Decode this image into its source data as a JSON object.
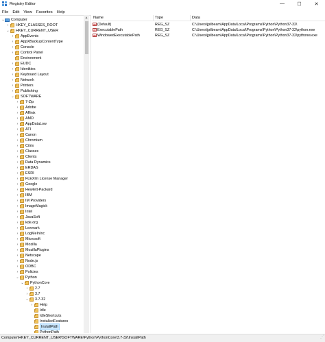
{
  "window": {
    "title": "Registry Editor",
    "minimize_glyph": "—",
    "maximize_glyph": "☐",
    "close_glyph": "✕"
  },
  "menu": [
    "File",
    "Edit",
    "View",
    "Favorites",
    "Help"
  ],
  "tree": [
    {
      "label": "Computer",
      "depth": 0,
      "expander": "⌄",
      "icon": "computer-icon"
    },
    {
      "label": "HKEY_CLASSES_ROOT",
      "depth": 1,
      "expander": "›",
      "icon": "folder-icon"
    },
    {
      "label": "HKEY_CURRENT_USER",
      "depth": 1,
      "expander": "⌄",
      "icon": "folder-icon"
    },
    {
      "label": "AppEvents",
      "depth": 2,
      "expander": "›",
      "icon": "folder-icon"
    },
    {
      "label": "AppXBackupContentType",
      "depth": 2,
      "expander": "›",
      "icon": "folder-icon"
    },
    {
      "label": "Console",
      "depth": 2,
      "expander": "›",
      "icon": "folder-icon"
    },
    {
      "label": "Control Panel",
      "depth": 2,
      "expander": "›",
      "icon": "folder-icon"
    },
    {
      "label": "Environment",
      "depth": 2,
      "expander": "",
      "icon": "folder-icon"
    },
    {
      "label": "EUDC",
      "depth": 2,
      "expander": "›",
      "icon": "folder-icon"
    },
    {
      "label": "Identities",
      "depth": 2,
      "expander": "›",
      "icon": "folder-icon"
    },
    {
      "label": "Keyboard Layout",
      "depth": 2,
      "expander": "›",
      "icon": "folder-icon"
    },
    {
      "label": "Network",
      "depth": 2,
      "expander": "›",
      "icon": "folder-icon"
    },
    {
      "label": "Printers",
      "depth": 2,
      "expander": "›",
      "icon": "folder-icon"
    },
    {
      "label": "Publishing",
      "depth": 2,
      "expander": "›",
      "icon": "folder-icon"
    },
    {
      "label": "SOFTWARE",
      "depth": 2,
      "expander": "⌄",
      "icon": "folder-icon"
    },
    {
      "label": "7-Zip",
      "depth": 3,
      "expander": "›",
      "icon": "folder-icon"
    },
    {
      "label": "Adobe",
      "depth": 3,
      "expander": "›",
      "icon": "folder-icon"
    },
    {
      "label": "Affinix",
      "depth": 3,
      "expander": "›",
      "icon": "folder-icon"
    },
    {
      "label": "AMD",
      "depth": 3,
      "expander": "›",
      "icon": "folder-icon"
    },
    {
      "label": "AppDataLow",
      "depth": 3,
      "expander": "›",
      "icon": "folder-icon"
    },
    {
      "label": "ATI",
      "depth": 3,
      "expander": "›",
      "icon": "folder-icon"
    },
    {
      "label": "Canon",
      "depth": 3,
      "expander": "›",
      "icon": "folder-icon"
    },
    {
      "label": "Chromium",
      "depth": 3,
      "expander": "›",
      "icon": "folder-icon"
    },
    {
      "label": "Citrix",
      "depth": 3,
      "expander": "›",
      "icon": "folder-icon"
    },
    {
      "label": "Classes",
      "depth": 3,
      "expander": "›",
      "icon": "folder-icon"
    },
    {
      "label": "Clients",
      "depth": 3,
      "expander": "›",
      "icon": "folder-icon"
    },
    {
      "label": "Data Dynamics",
      "depth": 3,
      "expander": "›",
      "icon": "folder-icon"
    },
    {
      "label": "ERDAS",
      "depth": 3,
      "expander": "›",
      "icon": "folder-icon"
    },
    {
      "label": "ESRI",
      "depth": 3,
      "expander": "›",
      "icon": "folder-icon"
    },
    {
      "label": "FLEXlm License Manager",
      "depth": 3,
      "expander": "›",
      "icon": "folder-icon"
    },
    {
      "label": "Google",
      "depth": 3,
      "expander": "›",
      "icon": "folder-icon"
    },
    {
      "label": "Hewlett-Packard",
      "depth": 3,
      "expander": "›",
      "icon": "folder-icon"
    },
    {
      "label": "IBM",
      "depth": 3,
      "expander": "›",
      "icon": "folder-icon"
    },
    {
      "label": "IM Providers",
      "depth": 3,
      "expander": "›",
      "icon": "folder-icon"
    },
    {
      "label": "ImageMagick",
      "depth": 3,
      "expander": "›",
      "icon": "folder-icon"
    },
    {
      "label": "Intel",
      "depth": 3,
      "expander": "›",
      "icon": "folder-icon"
    },
    {
      "label": "JavaSoft",
      "depth": 3,
      "expander": "›",
      "icon": "folder-icon"
    },
    {
      "label": "kde.org",
      "depth": 3,
      "expander": "›",
      "icon": "folder-icon"
    },
    {
      "label": "Lexmark",
      "depth": 3,
      "expander": "›",
      "icon": "folder-icon"
    },
    {
      "label": "LogMeInInc",
      "depth": 3,
      "expander": "›",
      "icon": "folder-icon"
    },
    {
      "label": "Microsoft",
      "depth": 3,
      "expander": "›",
      "icon": "folder-icon"
    },
    {
      "label": "Mozilla",
      "depth": 3,
      "expander": "›",
      "icon": "folder-icon"
    },
    {
      "label": "MozillaPlugins",
      "depth": 3,
      "expander": "›",
      "icon": "folder-icon"
    },
    {
      "label": "Netscape",
      "depth": 3,
      "expander": "›",
      "icon": "folder-icon"
    },
    {
      "label": "Node.js",
      "depth": 3,
      "expander": "›",
      "icon": "folder-icon"
    },
    {
      "label": "ODBC",
      "depth": 3,
      "expander": "›",
      "icon": "folder-icon"
    },
    {
      "label": "Policies",
      "depth": 3,
      "expander": "›",
      "icon": "folder-icon"
    },
    {
      "label": "Python",
      "depth": 3,
      "expander": "⌄",
      "icon": "folder-icon"
    },
    {
      "label": "PythonCore",
      "depth": 4,
      "expander": "⌄",
      "icon": "folder-icon"
    },
    {
      "label": "2.7",
      "depth": 5,
      "expander": "›",
      "icon": "folder-icon"
    },
    {
      "label": "3.7",
      "depth": 5,
      "expander": "›",
      "icon": "folder-icon"
    },
    {
      "label": "3.7-32",
      "depth": 5,
      "expander": "⌄",
      "icon": "folder-icon"
    },
    {
      "label": "Help",
      "depth": 6,
      "expander": "›",
      "icon": "folder-icon"
    },
    {
      "label": "Idle",
      "depth": 6,
      "expander": "",
      "icon": "folder-icon"
    },
    {
      "label": "IdleShortcuts",
      "depth": 6,
      "expander": "",
      "icon": "folder-icon"
    },
    {
      "label": "InstalledFeatures",
      "depth": 6,
      "expander": "",
      "icon": "folder-icon"
    },
    {
      "label": "InstallPath",
      "depth": 6,
      "expander": "",
      "icon": "folder-icon",
      "selected": true
    },
    {
      "label": "PythonPath",
      "depth": 6,
      "expander": "",
      "icon": "folder-icon"
    }
  ],
  "list": {
    "headers": {
      "name": "Name",
      "type": "Type",
      "data": "Data"
    },
    "rows": [
      {
        "name": "(Default)",
        "type": "REG_SZ",
        "data": "C:\\Users\\jpilbeam\\AppData\\Local\\Programs\\Python\\Python37-32\\"
      },
      {
        "name": "ExecutablePath",
        "type": "REG_SZ",
        "data": "C:\\Users\\jpilbeam\\AppData\\Local\\Programs\\Python\\Python37-32\\python.exe"
      },
      {
        "name": "WindowedExecutablePath",
        "type": "REG_SZ",
        "data": "C:\\Users\\jpilbeam\\AppData\\Local\\Programs\\Python\\Python37-32\\pythonw.exe"
      }
    ],
    "value_icon_text": "ab"
  },
  "status": {
    "path": "Computer\\HKEY_CURRENT_USER\\SOFTWARE\\Python\\PythonCore\\3.7-32\\InstallPath"
  }
}
